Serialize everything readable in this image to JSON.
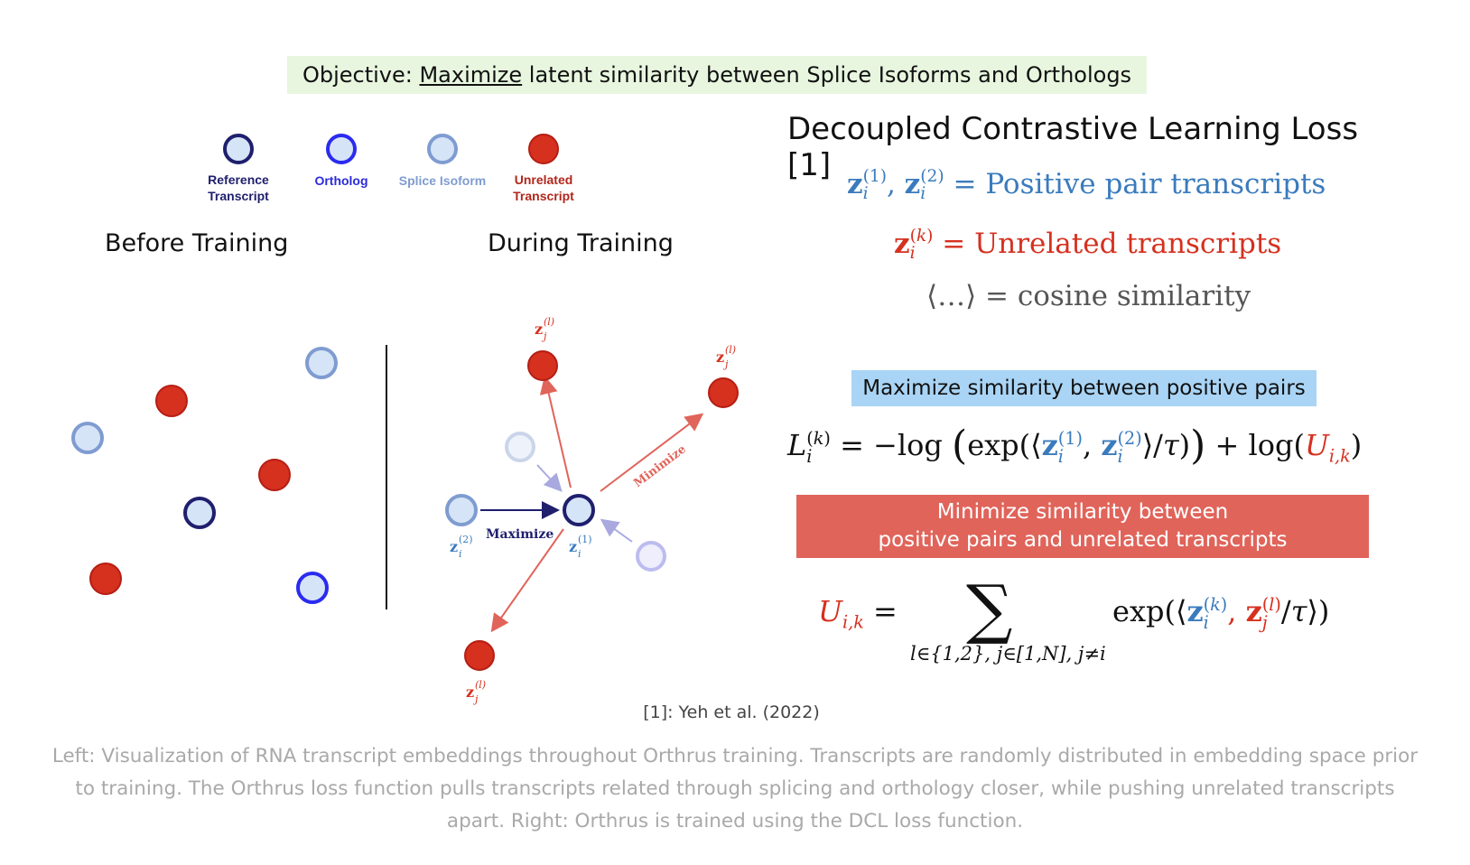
{
  "objective": {
    "prefix": "Objective: ",
    "emphasis": "Maximize",
    "suffix": " latent similarity between Splice Isoforms and Orthologs"
  },
  "legend": [
    {
      "label_line1": "Reference",
      "label_line2": "Transcript",
      "color": "#1f1f6e",
      "fill": "#d6e4f7",
      "text_color": "#1f1f6e"
    },
    {
      "label_line1": "Ortholog",
      "label_line2": "",
      "color": "#2b2bef",
      "fill": "#d6e4f7",
      "text_color": "#2b2bdb"
    },
    {
      "label_line1": "Splice Isoform",
      "label_line2": "",
      "color": "#7f9cd1",
      "fill": "#d6e4f7",
      "text_color": "#7f9cd1"
    },
    {
      "label_line1": "Unrelated",
      "label_line2": "Transcript",
      "color": "#cc2418",
      "fill": "#d6301f",
      "text_color": "#b3261b"
    }
  ],
  "panels": {
    "before_title": "Before Training",
    "during_title": "During Training"
  },
  "during_labels": {
    "maximize": "Maximize",
    "minimize": "Minimize",
    "z_i2": "z",
    "z_i2_sub": "i",
    "z_i2_sup": "(2)",
    "z_i1": "z",
    "z_i1_sub": "i",
    "z_i1_sup": "(1)",
    "z_jl": "z",
    "z_jl_sub": "j",
    "z_jl_sup": "(l)"
  },
  "dcl": {
    "title": "Decoupled Contrastive Learning Loss [1]",
    "line1_desc": "= Positive pair transcripts",
    "line2_desc": "= Unrelated transcripts",
    "line3": "⟨…⟩ = cosine similarity",
    "maximize_box": "Maximize similarity between positive pairs",
    "minimize_box_line1": "Minimize similarity between",
    "minimize_box_line2": "positive pairs and unrelated transcripts",
    "sum_subscript": "l∈{1,2}, j∈[1,N], j≠i"
  },
  "reference": "[1]: Yeh et al. (2022)",
  "caption": "Left: Visualization of RNA transcript embeddings throughout Orthrus training. Transcripts are randomly distributed in embedding space prior to training. The Orthrus loss function pulls transcripts related through splicing and orthology closer, while pushing unrelated transcripts apart. Right: Orthrus is trained using the DCL loss function.",
  "colors": {
    "positive_blue": "#3a7bbd",
    "unrelated_red": "#d6301f",
    "objective_bg": "#e8f6df",
    "maximize_bg": "#a9d4f5",
    "minimize_bg": "#e0645a",
    "caption_gray": "#a9a9a9"
  }
}
